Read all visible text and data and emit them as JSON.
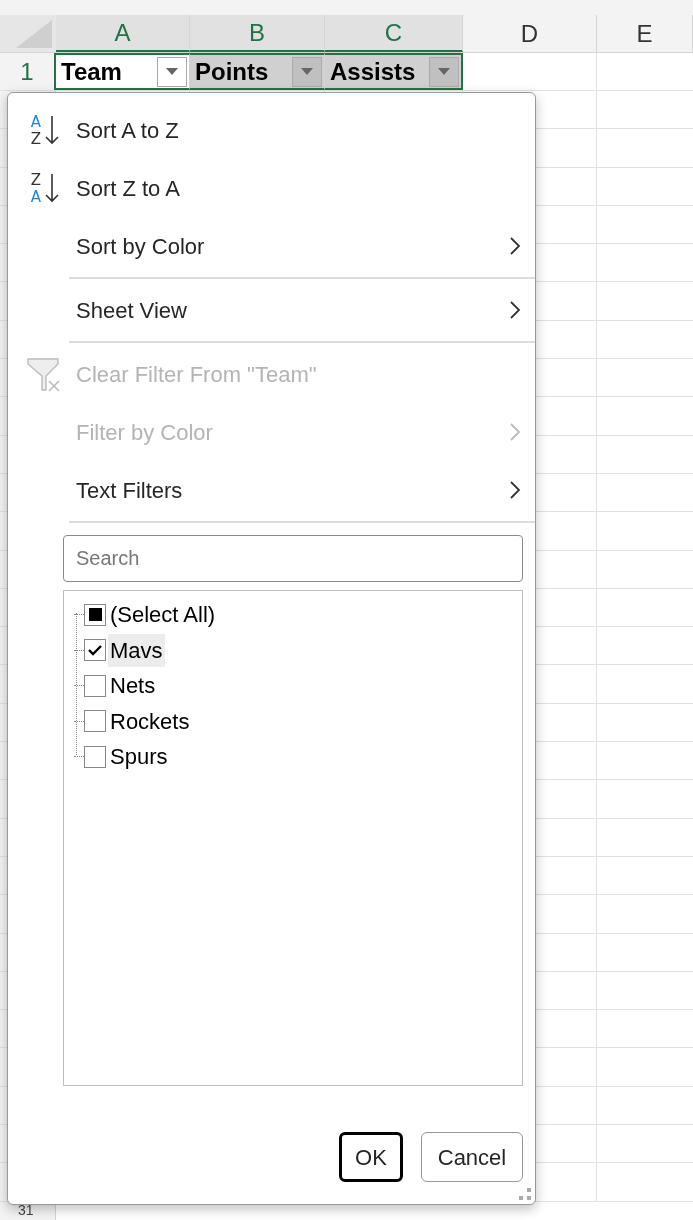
{
  "columns": [
    {
      "label": "A",
      "selected": true
    },
    {
      "label": "B",
      "selected": true
    },
    {
      "label": "C",
      "selected": true
    },
    {
      "label": "D",
      "selected": false
    },
    {
      "label": "E",
      "selected": false
    }
  ],
  "header_row": {
    "number": "1",
    "cells": [
      {
        "text": "Team",
        "filter_open": true
      },
      {
        "text": "Points",
        "filter_open": false
      },
      {
        "text": "Assists",
        "filter_open": false
      }
    ]
  },
  "last_row": {
    "number": "31"
  },
  "menu": {
    "items": [
      {
        "kind": "sort-ascending",
        "label": "Sort A to Z",
        "icon_top": "A",
        "icon_bottom": "Z",
        "disabled": false,
        "submenu": false,
        "separator_after": false
      },
      {
        "kind": "sort-descending",
        "label": "Sort Z to A",
        "icon_top": "Z",
        "icon_bottom": "A",
        "disabled": false,
        "submenu": false,
        "separator_after": false
      },
      {
        "kind": "plain",
        "label": "Sort by Color",
        "disabled": false,
        "submenu": true,
        "separator_after": true
      },
      {
        "kind": "plain",
        "label": "Sheet View",
        "disabled": false,
        "submenu": true,
        "separator_after": true
      },
      {
        "kind": "clear-filter",
        "label": "Clear Filter From \"Team\"",
        "disabled": true,
        "submenu": false,
        "separator_after": false
      },
      {
        "kind": "plain",
        "label": "Filter by Color",
        "disabled": true,
        "submenu": true,
        "separator_after": false
      },
      {
        "kind": "plain",
        "label": "Text Filters",
        "disabled": false,
        "submenu": true,
        "separator_after": true
      }
    ],
    "search": {
      "placeholder": "Search"
    },
    "values": [
      {
        "label": "(Select All)",
        "checked": false,
        "partial": true,
        "selected": false
      },
      {
        "label": "Mavs",
        "checked": true,
        "partial": false,
        "selected": true
      },
      {
        "label": "Nets",
        "checked": false,
        "partial": false,
        "selected": false
      },
      {
        "label": "Rockets",
        "checked": false,
        "partial": false,
        "selected": false
      },
      {
        "label": "Spurs",
        "checked": false,
        "partial": false,
        "selected": false
      }
    ],
    "buttons": [
      {
        "label": "OK",
        "default": true
      },
      {
        "label": "Cancel",
        "default": false
      }
    ]
  }
}
